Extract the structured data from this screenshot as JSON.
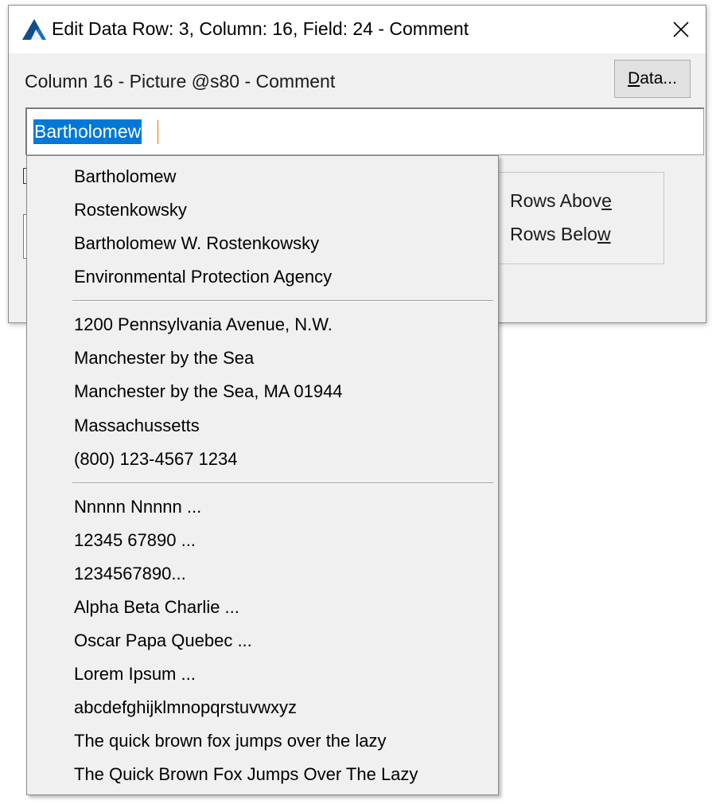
{
  "window": {
    "title": "Edit Data Row: 3, Column: 16, Field: 24 - Comment",
    "app_icon": "app-logo-icon",
    "close_icon": "close-icon"
  },
  "column_label": "Column 16 - Picture @s80 - Comment",
  "data_button": {
    "label_prefix": "D",
    "label_rest": "ata..."
  },
  "value_input": {
    "value": "Bartholomew",
    "selection_color": "#0078d7"
  },
  "rows_group": {
    "above": {
      "label_prefix": "Rows Abov",
      "label_mnemonic": "e"
    },
    "below": {
      "label_prefix": "Rows Belo",
      "label_mnemonic": "w"
    }
  },
  "popup_menu": {
    "group1": [
      "Bartholomew",
      "Rostenkowsky",
      "Bartholomew W. Rostenkowsky",
      "Environmental Protection Agency"
    ],
    "group2": [
      "1200 Pennsylvania Avenue, N.W.",
      "Manchester by the Sea",
      "Manchester by the Sea, MA 01944",
      "Massachussetts",
      "(800) 123-4567 1234"
    ],
    "group3": [
      "Nnnnn Nnnnn ...",
      "12345 67890 ...",
      "1234567890...",
      "Alpha Beta Charlie ...",
      "Oscar Papa Quebec ...",
      "Lorem Ipsum ...",
      "abcdefghijklmnopqrstuvwxyz",
      "The quick brown fox jumps over the lazy",
      "The Quick Brown Fox Jumps Over The Lazy"
    ]
  }
}
